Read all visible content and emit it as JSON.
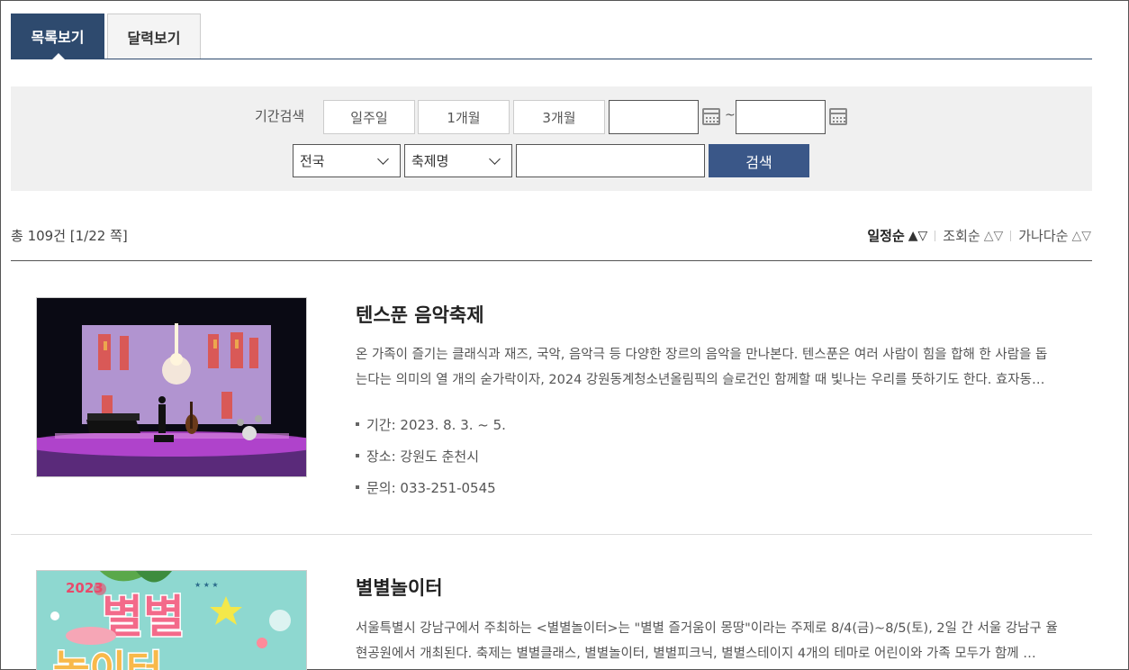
{
  "tabs": [
    {
      "label": "목록보기",
      "active": true
    },
    {
      "label": "달력보기",
      "active": false
    }
  ],
  "search": {
    "period_label": "기간검색",
    "period_buttons": [
      "일주일",
      "1개월",
      "3개월"
    ],
    "start_date": "",
    "end_date": "",
    "range_separator": "~",
    "region_select": "전국",
    "field_select": "축제명",
    "keyword": "",
    "submit_label": "검색"
  },
  "result": {
    "count_text": "총 109건 [1/22 쪽]",
    "sorts": [
      {
        "label": "일정순",
        "arrows": "▲▽",
        "active": true
      },
      {
        "label": "조회순",
        "arrows": "△▽",
        "active": false
      },
      {
        "label": "가나다순",
        "arrows": "△▽",
        "active": false
      }
    ]
  },
  "festivals": [
    {
      "title": "텐스푼 음악축제",
      "desc_line1": "온 가족이 즐기는 클래식과 재즈, 국악, 음악극 등 다양한 장르의 음악을 만나본다. 텐스푼은 여러 사람이 힘을 합해 한 사람을 돕",
      "desc_line2": "는다는 의미의 열 개의 숟가락이자, 2024 강원동계청소년올림픽의 슬로건인 함께할 때 빛나는 우리를 뜻하기도 한다. 효자동…",
      "period": "기간: 2023. 8. 3. ~ 5.",
      "place": "장소: 강원도 춘천시",
      "contact": "문의: 033-251-0545"
    },
    {
      "title": "별별놀이터",
      "desc_line1": "서울특별시 강남구에서 주최하는 <별별놀이터>는 \"별별 즐거움이 몽땅\"이라는 주제로 8/4(금)~8/5(토), 2일 간 서울 강남구 율",
      "desc_line2": "현공원에서 개최된다. 축제는 별별클래스, 별별놀이터, 별별피크닉, 별별스테이지 4개의 테마로 어린이와 가족 모두가 함께 …",
      "poster_text": [
        "2023",
        "별별",
        "놀이터"
      ]
    }
  ]
}
